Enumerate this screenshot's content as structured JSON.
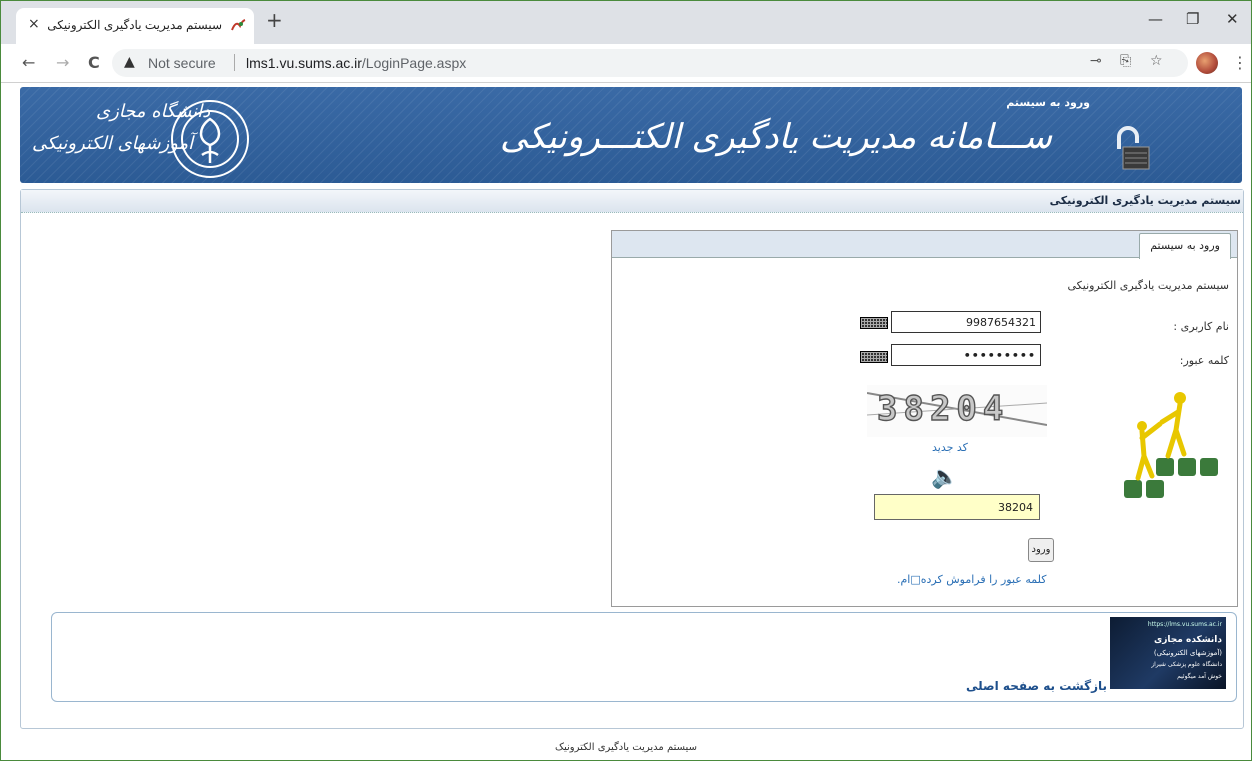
{
  "browser": {
    "tab_title": "سیستم مدیریت یادگیری الکترونیکی",
    "tab_close": "×",
    "new_tab": "+",
    "window_controls": {
      "minimize": "—",
      "restore": "❐",
      "close": "✕"
    },
    "nav": {
      "back": "←",
      "forward": "→",
      "reload": "C"
    },
    "address": {
      "security_label": "Not secure",
      "host": "lms1.vu.sums.ac.ir",
      "path": "/LoginPage.aspx"
    },
    "icons": [
      "key-icon",
      "translate-icon",
      "star-icon",
      "profile-avatar",
      "menu-icon"
    ]
  },
  "banner": {
    "title": "ســـامانه مدیریت یادگیری الکتـــرونیکی",
    "login_label": "ورود به سیستم",
    "logo_line1": "دانشگاه مجازی",
    "logo_line2": "آموزشهای الکترونیکی",
    "bg_color": "#2f5f9a"
  },
  "subheader": {
    "text": "سیستم مدیریت یادگیری الکترونیکی"
  },
  "login": {
    "tab_label": "ورود به سیستم",
    "heading": "سیستم مدیریت یادگیری الکترونیکی",
    "username_label": "نام کاربری :",
    "username_value": "9987654321",
    "password_label": "کلمه عبور:",
    "password_value": "•••••••••",
    "captcha_text": "38204",
    "new_code": "کد جدید",
    "captcha_input": "38204",
    "submit_label": "ورود",
    "forgot_label": "کلمه عبور را فراموش کرده□ام."
  },
  "bottom": {
    "thumb_url": "https://lms.vu.sums.ac.ir",
    "thumb_title": "دانشکده مجازی",
    "thumb_sub": "(آموزشهای الکترونیکی)",
    "thumb_line3": "دانشگاه علوم پزشکی شیراز",
    "thumb_line4": "خوش آمد میگوئیم",
    "back_link": "بازگشت به صفحه اصلی"
  },
  "footer": {
    "text": "سیستم مدیریت یادگیری الکترونیک"
  }
}
